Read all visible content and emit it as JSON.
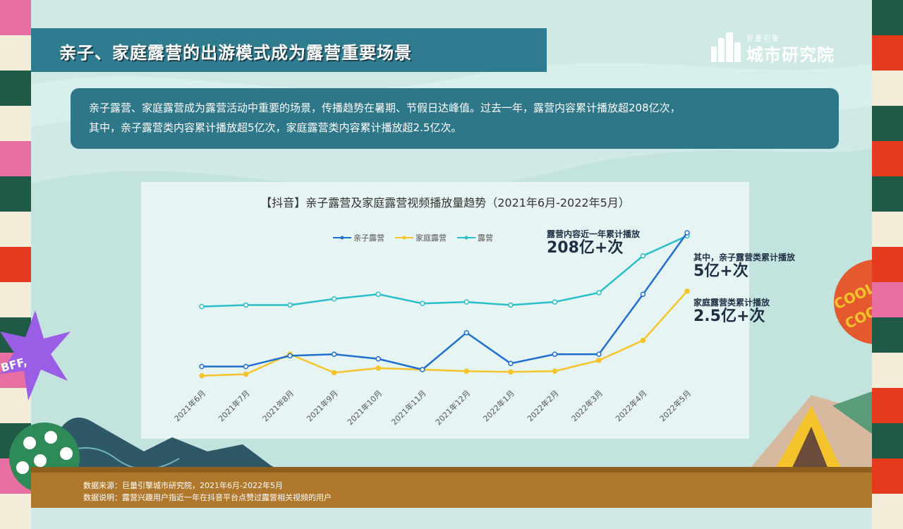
{
  "title": "亲子、家庭露营的出游模式成为露营重要场景",
  "logo": {
    "small": "巨量引擎",
    "big": "城市研究院"
  },
  "summary": {
    "line1": "亲子露营、家庭露营成为露营活动中重要的场景，传播趋势在暑期、节假日达峰值。过去一年，露营内容累计播放超208亿次，",
    "line2": "其中，亲子露营类内容累计播放超5亿次，家庭露营类内容累计播放超2.5亿次。"
  },
  "annotations": {
    "total_label": "露营内容近一年累计播放",
    "total_value": "208亿+次",
    "parent_label": "其中，亲子露营类累计播放",
    "parent_value": "5亿+次",
    "family_label": "家庭露营类累计播放",
    "family_value": "2.5亿+次"
  },
  "footer": {
    "source": "数据来源：巨量引擎城市研究院，2021年6月-2022年5月",
    "note": "数据说明：露营兴趣用户指近一年在抖音平台点赞过露营相关视频的用户"
  },
  "decor": {
    "bff": "BFF,",
    "cool": "COOL"
  },
  "colors": {
    "parent": "#1f6fd1",
    "family": "#f5c32c",
    "camping": "#29bfc8",
    "title_bar": "#2f7b8f",
    "summary_bg": "#2e7789"
  },
  "chart_data": {
    "type": "line",
    "title": "【抖音】亲子露营及家庭露营视频播放量趋势（2021年6月-2022年5月）",
    "categories": [
      "2021年6月",
      "2021年7月",
      "2021年8月",
      "2021年9月",
      "2021年10月",
      "2021年11月",
      "2021年12月",
      "2022年1月",
      "2022年2月",
      "2022年3月",
      "2022年4月",
      "2022年5月"
    ],
    "series": [
      {
        "name": "亲子露营",
        "values": [
          13,
          13,
          20,
          21,
          18,
          11,
          35,
          15,
          21,
          21,
          60,
          100
        ]
      },
      {
        "name": "家庭露营",
        "values": [
          7,
          8,
          21,
          9,
          12,
          11,
          10,
          9.5,
          10,
          17,
          30,
          62
        ]
      },
      {
        "name": "露营",
        "values": [
          52,
          53,
          53,
          57,
          60,
          54,
          55,
          53,
          55,
          61,
          85,
          98
        ]
      }
    ],
    "ylim": [
      0,
      100
    ],
    "legend": "top-center",
    "grid": false,
    "y_axis_shown": false
  }
}
